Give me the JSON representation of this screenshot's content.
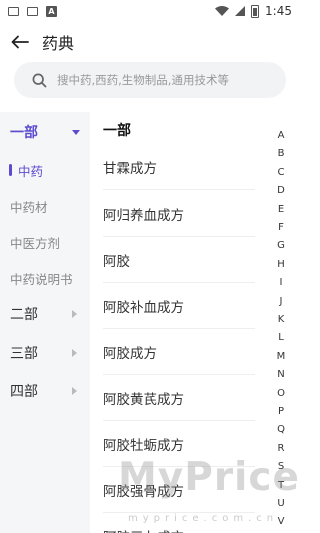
{
  "status_bar": {
    "time": "1:45"
  },
  "header": {
    "title": "药典"
  },
  "search": {
    "placeholder": "搜中药,西药,生物制品,通用技术等"
  },
  "sidebar": {
    "categories": [
      {
        "label": "一部",
        "expanded": true
      },
      {
        "label": "二部",
        "expanded": false
      },
      {
        "label": "三部",
        "expanded": false
      },
      {
        "label": "四部",
        "expanded": false
      }
    ],
    "subitems": [
      {
        "label": "中药",
        "active": true
      },
      {
        "label": "中药材",
        "active": false
      },
      {
        "label": "中医方剂",
        "active": false
      },
      {
        "label": "中药说明书",
        "active": false
      }
    ]
  },
  "main": {
    "section_title": "一部",
    "items": [
      "甘霖成方",
      "阿归养血成方",
      "阿胶",
      "阿胶补血成方",
      "阿胶成方",
      "阿胶黄芪成方",
      "阿胶牡蛎成方",
      "阿胶强骨成方",
      "阿胶三七成方"
    ]
  },
  "alphabet": [
    "A",
    "B",
    "C",
    "D",
    "E",
    "F",
    "G",
    "H",
    "I",
    "J",
    "K",
    "L",
    "M",
    "N",
    "O",
    "P",
    "Q",
    "R",
    "S",
    "T",
    "U",
    "V"
  ],
  "colors": {
    "accent": "#5b4ccf",
    "sidebar_bg": "#f5f6f8",
    "search_bg": "#f2f3f5"
  },
  "watermark": {
    "brand": "MyPrice",
    "url": "myprice.com.cn"
  }
}
